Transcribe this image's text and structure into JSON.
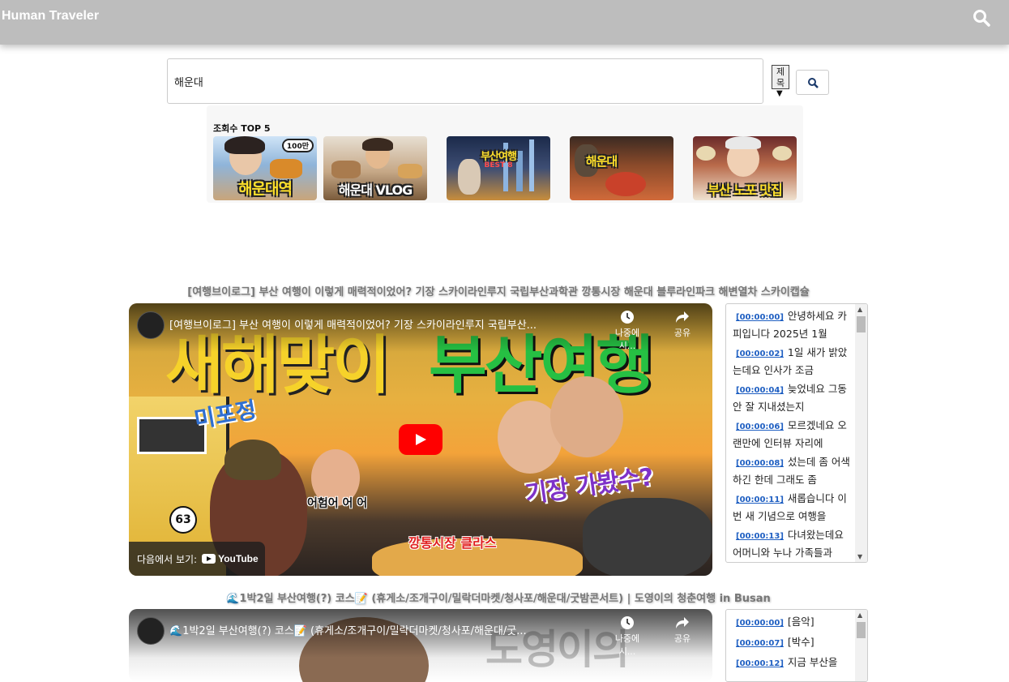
{
  "header": {
    "brand": "Human Traveler",
    "search_icon": "search-icon"
  },
  "search": {
    "value": "해운대",
    "filter": "제목",
    "filter_arrow": "▼",
    "button_icon": "search-icon"
  },
  "top5": {
    "title": "조회수 TOP 5",
    "items": [
      {
        "caption": "해운대역",
        "badge": "100만"
      },
      {
        "caption": "해운대 VLOG"
      },
      {
        "caption": "부산여행",
        "sub": "BEST 8"
      },
      {
        "caption": "해운대"
      },
      {
        "caption": "부산 노포 맛집"
      }
    ]
  },
  "videos": [
    {
      "title": "[여행브이로그] 부산 여행이 이렇게 매력적이었어? 기장 스카이라인루지 국립부산과학관 깡통시장 해운대 블루라인파크 해변열차 스카이캡슐",
      "overlay_title": "[여행브이로그] 부산 여행이 이렇게 매력적이었어? 기장 스카이라인루지 국립부산...",
      "watch_later": "나중에 시...",
      "share": "공유",
      "watch_on": "다음에서 보기:",
      "youtube": "YouTube",
      "thumb_text_1": "새해맞이",
      "thumb_text_2": "부산여행",
      "thumb_text_3": "미포정",
      "thumb_text_4": "기장 가봤수?",
      "thumb_text_5": "깡통시장 클라스",
      "thumb_text_6": "어험어 어 어",
      "tram_number": "63",
      "transcript": [
        {
          "time": "[00:00:00]",
          "text": "안녕하세요 카피입니다 2025년 1월"
        },
        {
          "time": "[00:00:02]",
          "text": "1일 새가 밝았는데요 인사가 조금"
        },
        {
          "time": "[00:00:04]",
          "text": "늦었네요 그동안 잘 지내셨는지"
        },
        {
          "time": "[00:00:06]",
          "text": "모르겠네요 오랜만에 인터뷰 자리에"
        },
        {
          "time": "[00:00:08]",
          "text": "섰는데 좀 어색하긴 한데 그래도 좀"
        },
        {
          "time": "[00:00:11]",
          "text": "새롭습니다 이번 새 기념으로 여행을"
        },
        {
          "time": "[00:00:13]",
          "text": "다녀왔는데요 어머니와 누나 가족들과"
        }
      ]
    },
    {
      "title": "🌊1박2일 부산여행(?) 코스📝 (휴게소/조개구이/밀락더마켓/청사포/해운대/굿밤콘서트) | 도영이의 청춘여행 in Busan",
      "overlay_title": "🌊1박2일 부산여행(?) 코스📝 (휴게소/조개구이/밀락더마켓/청사포/해운대/굿...",
      "watch_later": "나중에 시...",
      "share": "공유",
      "thumb_text_1": "도영이의",
      "transcript": [
        {
          "time": "[00:00:00]",
          "text": "[음악]"
        },
        {
          "time": "[00:00:07]",
          "text": "[박수]"
        },
        {
          "time": "[00:00:12]",
          "text": "지금 부산을"
        }
      ]
    }
  ]
}
